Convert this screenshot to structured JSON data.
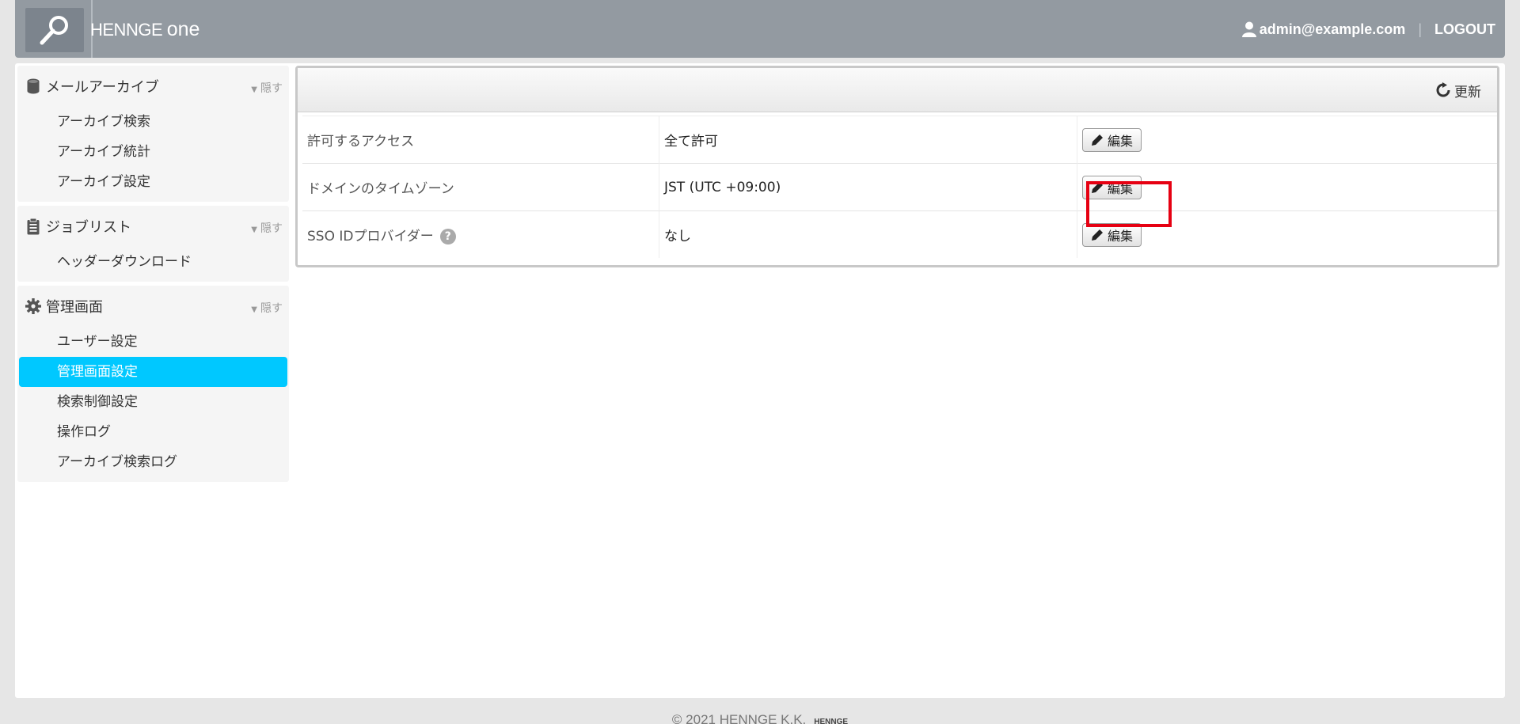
{
  "header": {
    "brand_main": "HENNGE ",
    "brand_one": "one",
    "user_email": "admin@example.com",
    "separator": "|",
    "logout_label": "LOGOUT",
    "icons": [
      "magnifier-logo-icon",
      "user-icon"
    ]
  },
  "sidebar": {
    "hide_label": "隠す",
    "sections": [
      {
        "title": "メールアーカイブ",
        "icon": "database-icon",
        "items": [
          "アーカイブ検索",
          "アーカイブ統計",
          "アーカイブ設定"
        ]
      },
      {
        "title": "ジョブリスト",
        "icon": "clipboard-icon",
        "items": [
          "ヘッダーダウンロード"
        ]
      },
      {
        "title": "管理画面",
        "icon": "gear-icon",
        "items": [
          "ユーザー設定",
          "管理画面設定",
          "検索制御設定",
          "操作ログ",
          "アーカイブ検索ログ"
        ],
        "active_item": "管理画面設定"
      }
    ]
  },
  "toolbar": {
    "refresh_label": "更新"
  },
  "settings": {
    "edit_label": "編集",
    "rows": [
      {
        "label": "許可するアクセス",
        "value": "全て許可"
      },
      {
        "label": "ドメインのタイムゾーン",
        "value": "JST (UTC +09:00)"
      },
      {
        "label": "SSO IDプロバイダー",
        "value": "なし",
        "help": "?"
      }
    ]
  },
  "colors": {
    "header_bg": "#939aa1",
    "active_item_bg": "#00c8ff",
    "highlight_border": "#e60012"
  },
  "footer": {
    "copyright": "© 2021 HENNGE K.K.",
    "logo_text": "HENNGE"
  }
}
